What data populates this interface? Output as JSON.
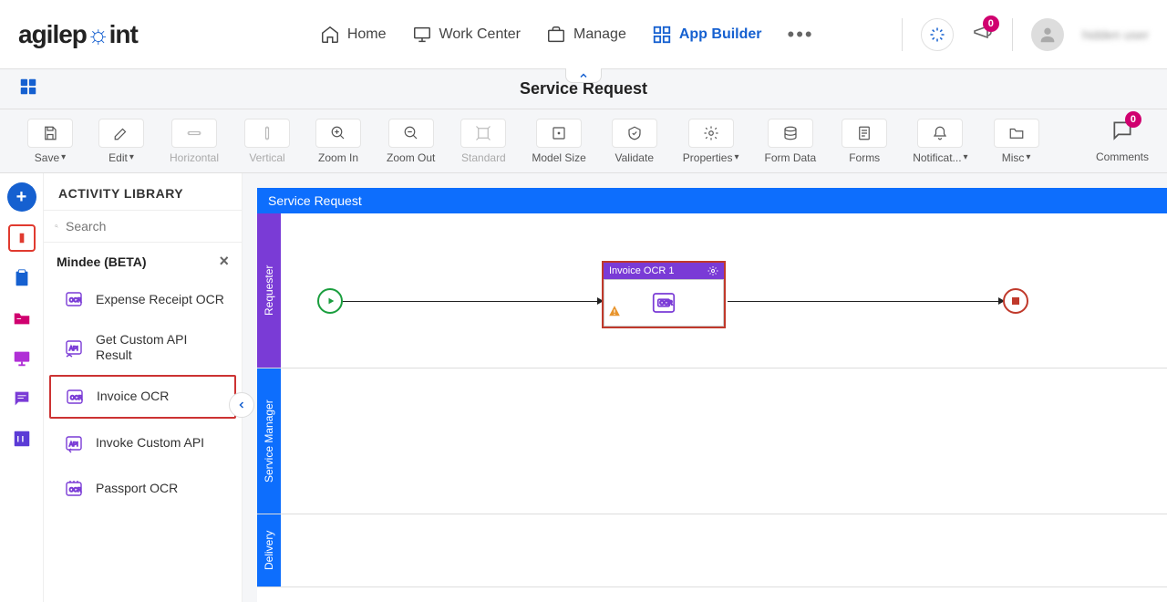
{
  "header": {
    "logo_main": "agilep",
    "logo_rest": "int",
    "nav": [
      {
        "label": "Home"
      },
      {
        "label": "Work Center"
      },
      {
        "label": "Manage"
      },
      {
        "label": "App Builder"
      }
    ],
    "notification_count": "0",
    "username": "hidden user"
  },
  "page": {
    "title": "Service Request"
  },
  "toolbar": {
    "save": "Save",
    "edit": "Edit",
    "horizontal": "Horizontal",
    "vertical": "Vertical",
    "zoom_in": "Zoom In",
    "zoom_out": "Zoom Out",
    "standard": "Standard",
    "model_size": "Model Size",
    "validate": "Validate",
    "properties": "Properties",
    "form_data": "Form Data",
    "forms": "Forms",
    "notifications": "Notificat...",
    "misc": "Misc",
    "comments": "Comments",
    "comments_count": "0"
  },
  "library": {
    "title": "ACTIVITY LIBRARY",
    "search_placeholder": "Search",
    "category": "Mindee (BETA)",
    "items": [
      {
        "label": "Expense Receipt OCR"
      },
      {
        "label": "Get Custom API Result"
      },
      {
        "label": "Invoice OCR"
      },
      {
        "label": "Invoke Custom API"
      },
      {
        "label": "Passport OCR"
      }
    ]
  },
  "canvas": {
    "title": "Service Request",
    "lanes": [
      {
        "label": "Requester"
      },
      {
        "label": "Service Manager"
      },
      {
        "label": "Delivery"
      }
    ],
    "activity": {
      "title": "Invoice OCR 1"
    }
  }
}
